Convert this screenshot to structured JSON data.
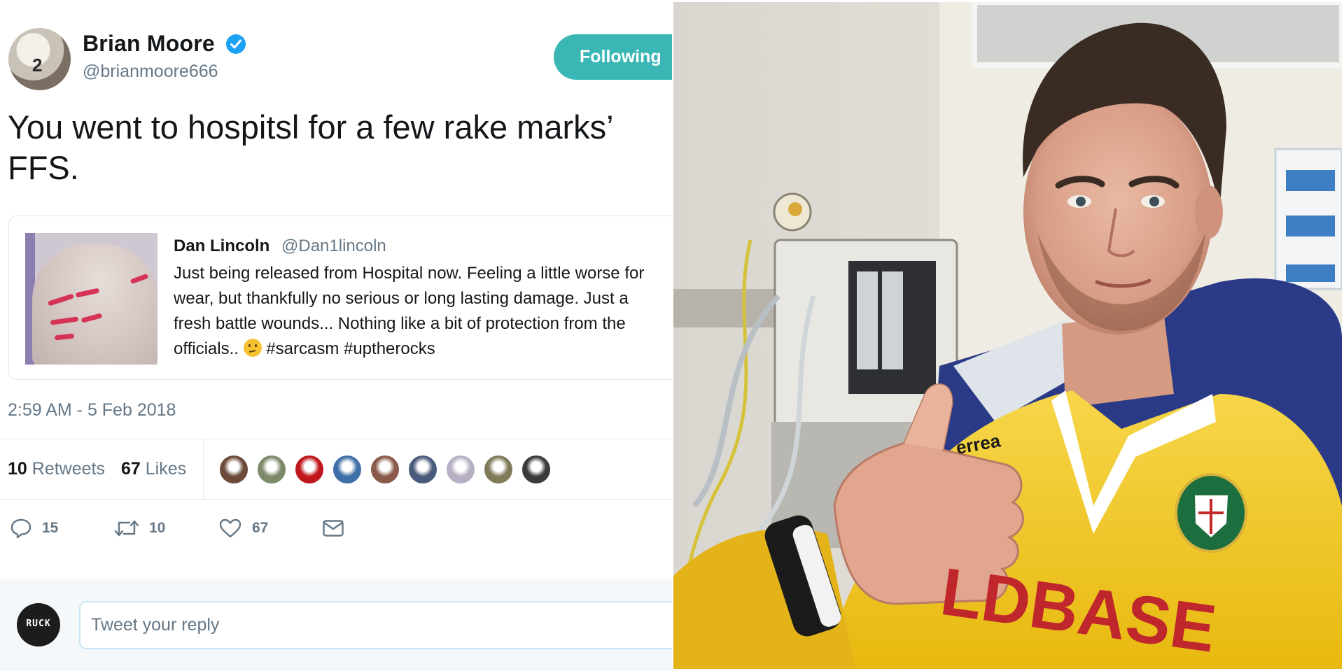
{
  "tweet": {
    "author": {
      "name": "Brian Moore",
      "handle": "@brianmoore666",
      "verified": true,
      "avatar_icon": "rugby-player-avatar",
      "avatar_jersey_number": "2"
    },
    "follow_button": {
      "label": "Following",
      "color": "#3ab7b4"
    },
    "text_lines": [
      "You went to hospitsl for a few rake marks’",
      "FFS."
    ],
    "quoted_tweet": {
      "author_name": "Dan Lincoln",
      "author_handle": "@Dan1lincoln",
      "text_lines": [
        "Just being released from Hospital now. Feeling a little worse for",
        "wear, but thankfully no serious or long lasting damage. Just a",
        "fresh battle wounds... Nothing like a bit of protection from the",
        "officials.."
      ],
      "emoji_icon": "thinking-face-emoji",
      "hashtags": "#sarcasm #uptherocks",
      "image_icon": "scratched-back-photo"
    },
    "timestamp": "2:59 AM - 5 Feb 2018",
    "stats": {
      "retweets_count": "10",
      "retweets_label": "Retweets",
      "likes_count": "67",
      "likes_label": "Likes"
    },
    "likers": [
      {
        "icon": "liker-avatar-1",
        "color": "#6b4a3a"
      },
      {
        "icon": "liker-avatar-2",
        "color": "#7d8a6a"
      },
      {
        "icon": "liker-avatar-3",
        "color": "#c0161c"
      },
      {
        "icon": "liker-avatar-4",
        "color": "#3f6fa8"
      },
      {
        "icon": "liker-avatar-5",
        "color": "#8a5a4a"
      },
      {
        "icon": "liker-avatar-6",
        "color": "#4a5a7a"
      },
      {
        "icon": "liker-avatar-7",
        "color": "#b7b0c4"
      },
      {
        "icon": "liker-avatar-8",
        "color": "#7f7a5a"
      },
      {
        "icon": "liker-avatar-9",
        "color": "#3a3a3a"
      }
    ],
    "actions": {
      "reply": {
        "icon": "reply-icon",
        "count": "15"
      },
      "retweet": {
        "icon": "retweet-icon",
        "count": "10"
      },
      "like": {
        "icon": "heart-icon",
        "count": "67"
      },
      "dm": {
        "icon": "envelope-icon"
      }
    },
    "reply_box": {
      "placeholder": "Tweet your reply",
      "avatar_text": "RUCK"
    }
  },
  "photo": {
    "subject": "hospital-selfie-thumbs-up",
    "shirt_text": "LDBASE",
    "shirt_brand": "errea",
    "shirt_color": "#f2c81e"
  },
  "colors": {
    "accent": "#3ab7b4",
    "verified": "#1da1f2",
    "muted_text": "#657786",
    "text": "#14171a"
  }
}
